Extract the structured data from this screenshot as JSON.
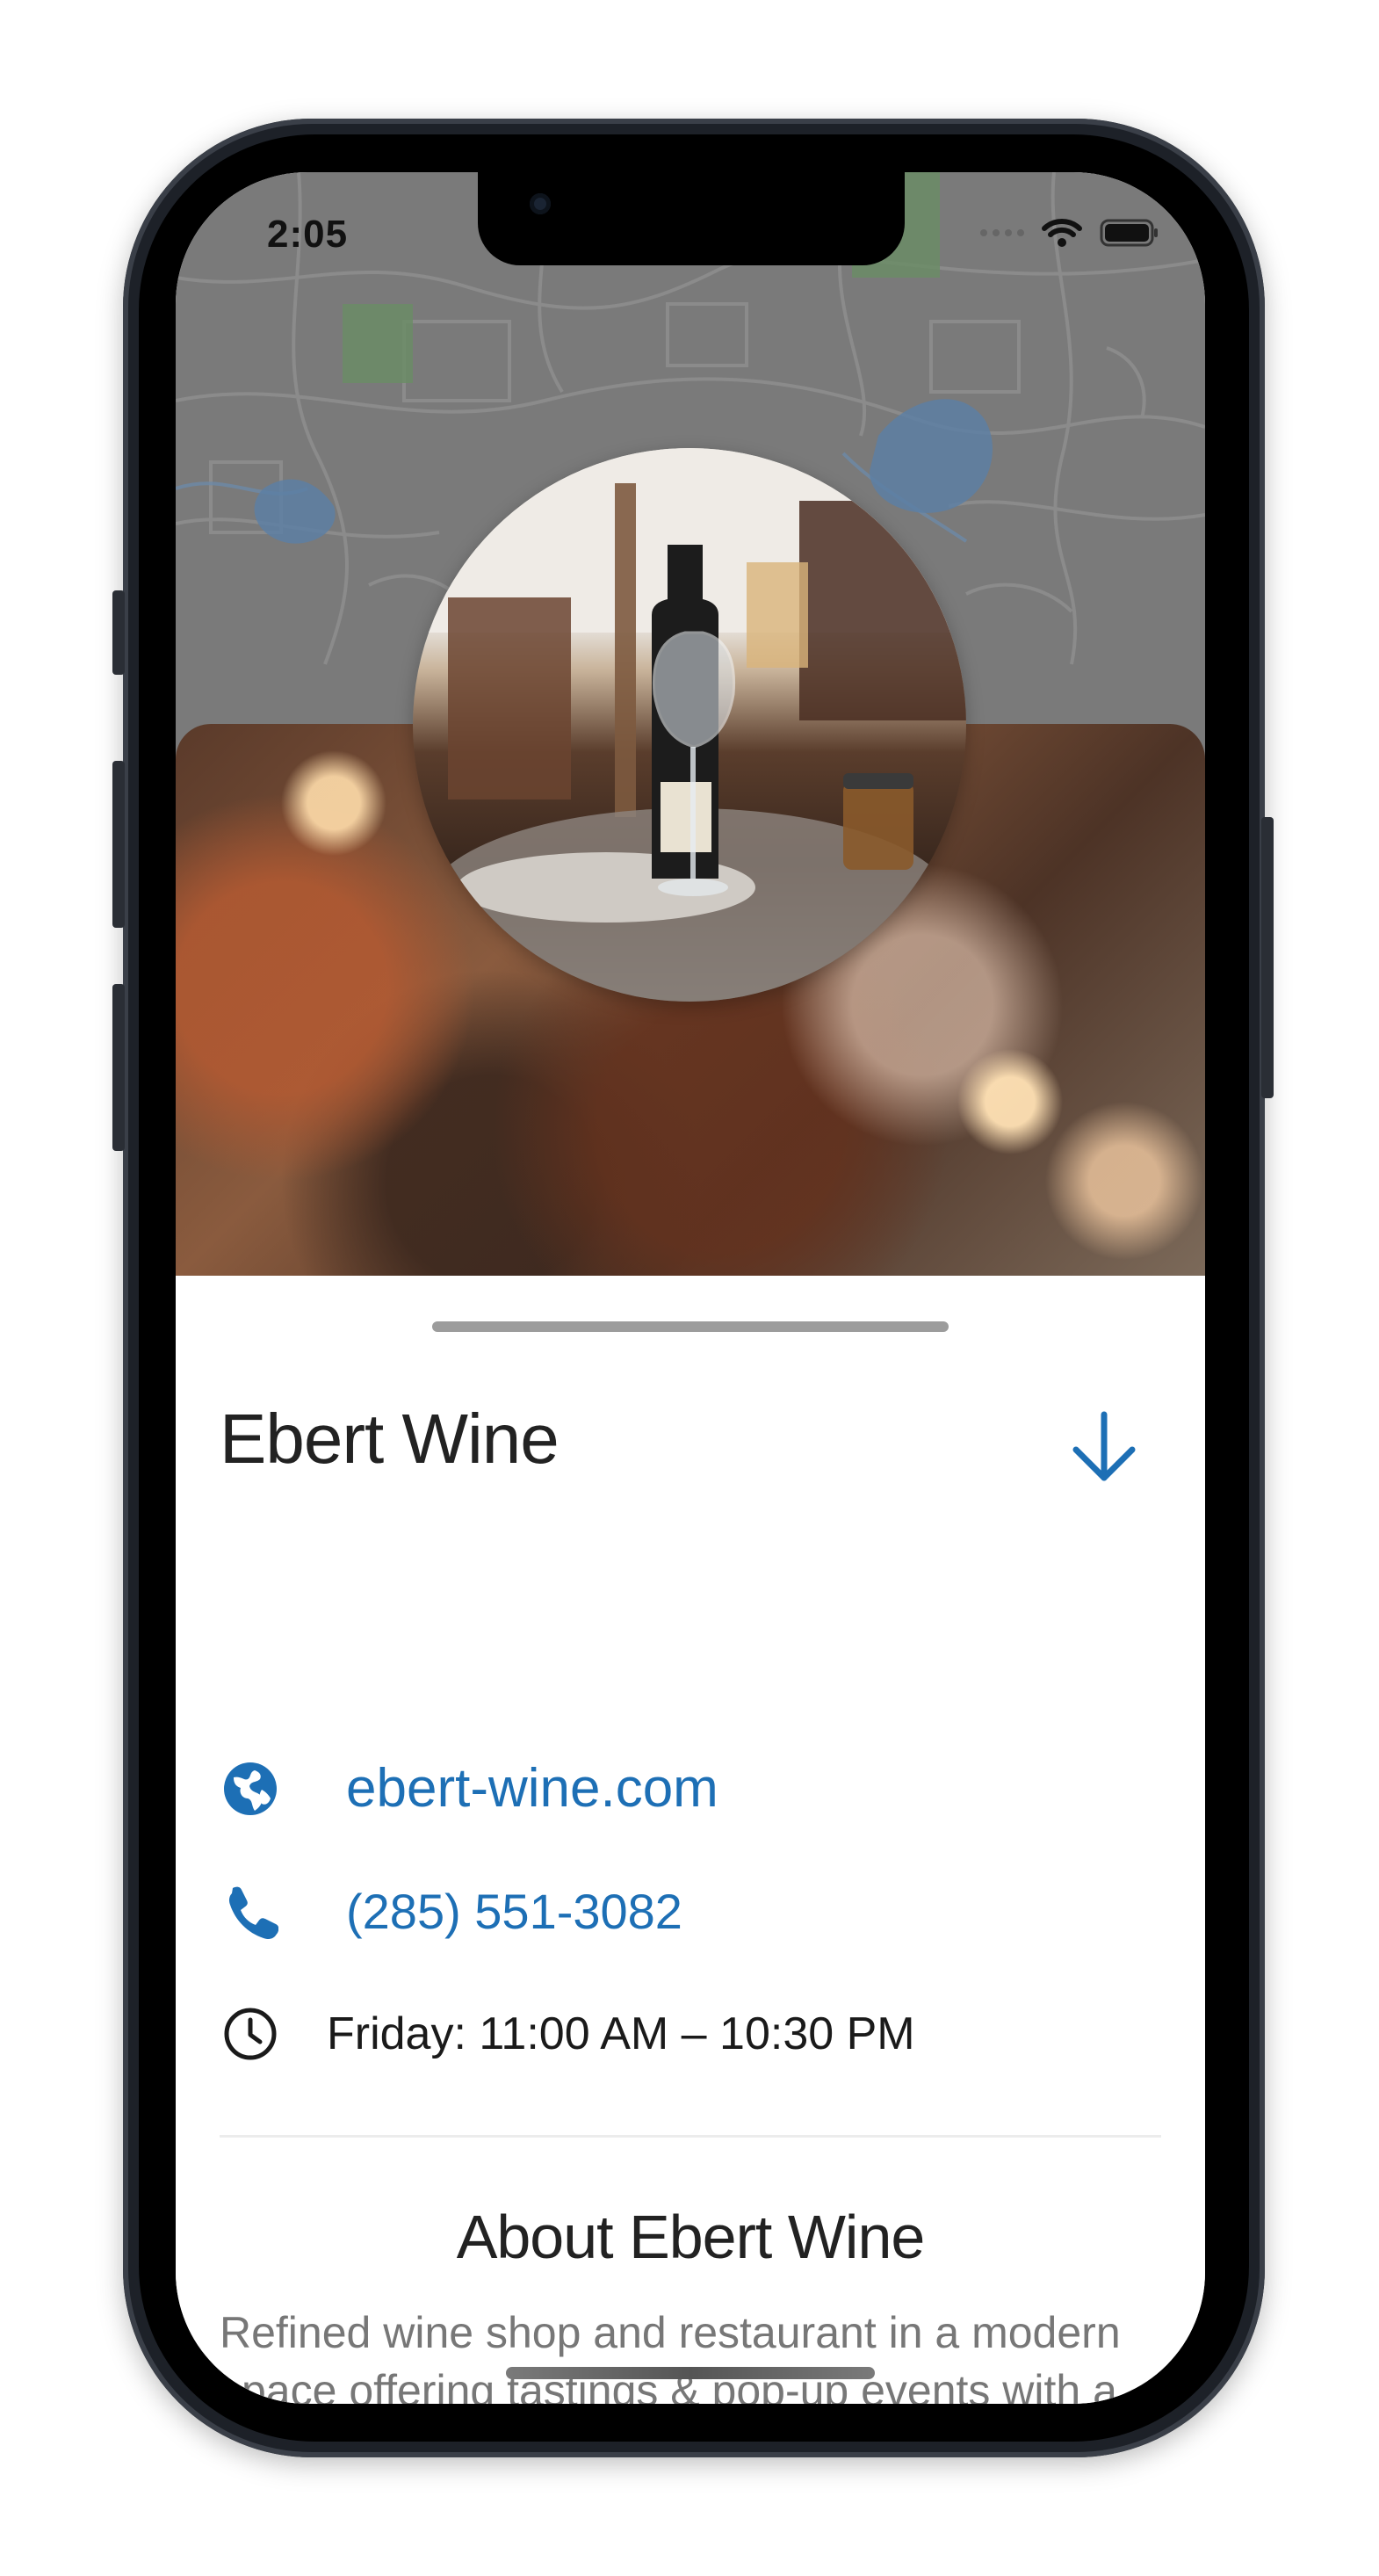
{
  "status_bar": {
    "time": "2:05",
    "icons": [
      "cellular-dots-icon",
      "wifi-icon",
      "battery-icon"
    ]
  },
  "place": {
    "name": "Ebert Wine",
    "website": "ebert-wine.com",
    "phone": "(285) 551-3082",
    "hours": "Friday: 11:00 AM – 10:30 PM"
  },
  "about": {
    "title": "About Ebert Wine",
    "text": "Refined wine shop and restaurant in a modern space offering tastings & pop-up events with a down-to-earth vibe. We offer the best of the Old World and the New."
  },
  "colors": {
    "accent": "#1d6fb5",
    "map_background": "#7a7a7a",
    "text_primary": "#222222",
    "text_secondary": "#777777"
  },
  "icons": {
    "website": "globe-icon",
    "phone": "phone-icon",
    "hours": "clock-icon",
    "collapse": "arrow-down-icon"
  }
}
